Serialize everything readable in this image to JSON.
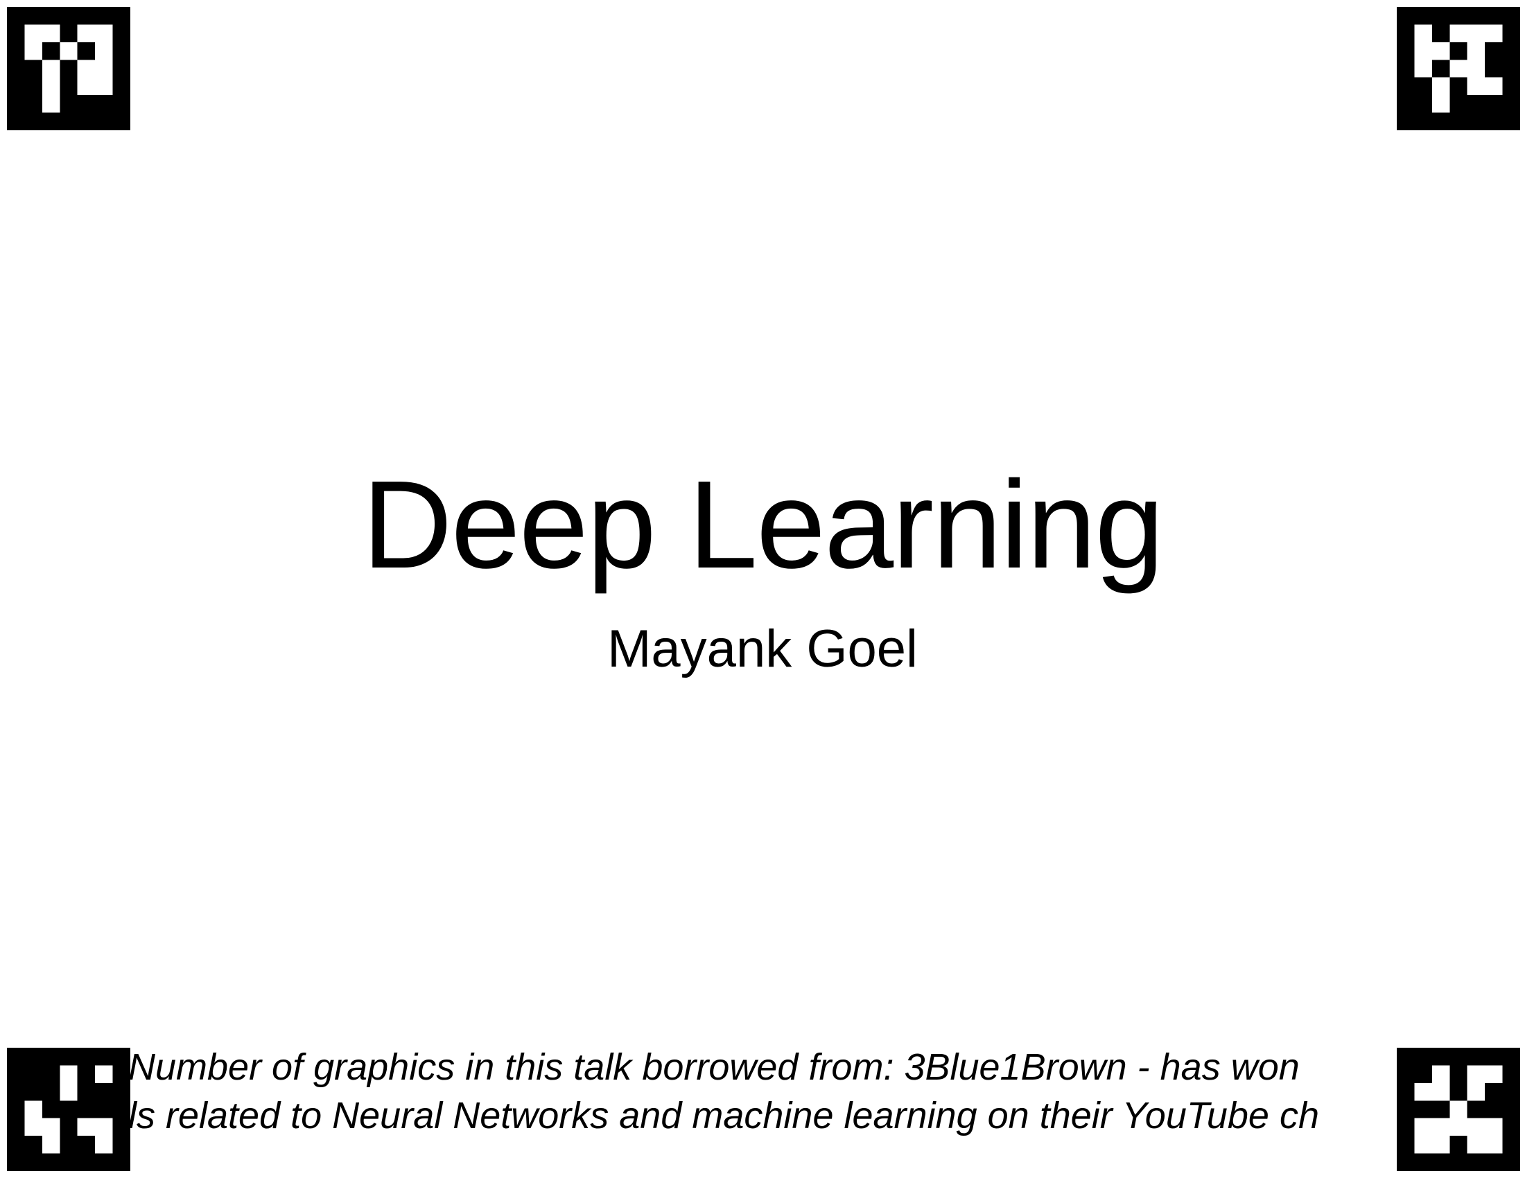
{
  "slide": {
    "title": "Deep Learning",
    "author": "Mayank Goel",
    "footnote": {
      "lines": [
        "Number of graphics in this talk borrowed from: 3Blue1Brown - has won",
        "ls related to Neural Networks and machine learning on their YouTube ch"
      ]
    }
  },
  "markers": [
    {
      "name": "fiducial-marker-top-left",
      "icon": "aruco-marker-icon"
    },
    {
      "name": "fiducial-marker-top-right",
      "icon": "aruco-marker-icon"
    },
    {
      "name": "fiducial-marker-bottom-left",
      "icon": "aruco-marker-icon"
    },
    {
      "name": "fiducial-marker-bottom-right",
      "icon": "aruco-marker-icon"
    }
  ],
  "colors": {
    "background": "#ffffff",
    "text": "#000000",
    "marker": "#000000"
  }
}
